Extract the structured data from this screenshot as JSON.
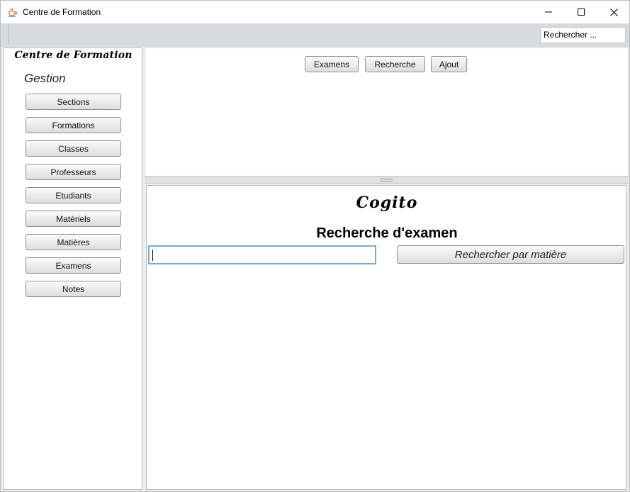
{
  "window": {
    "title": "Centre de Formation",
    "icon": "coffee-cup-app-icon"
  },
  "toolbar": {
    "search_value": "Rechercher ..."
  },
  "sidebar": {
    "brand": "Centre de Formation",
    "section_label": "Gestion",
    "items": [
      {
        "label": "Sections"
      },
      {
        "label": "Formations"
      },
      {
        "label": "Classes"
      },
      {
        "label": "Professeurs"
      },
      {
        "label": "Etudiants"
      },
      {
        "label": "Matériels"
      },
      {
        "label": "Matières"
      },
      {
        "label": "Examens"
      },
      {
        "label": "Notes"
      }
    ]
  },
  "top_panel": {
    "buttons": [
      {
        "label": "Examens"
      },
      {
        "label": "Recherche"
      },
      {
        "label": "Ajout"
      }
    ]
  },
  "main": {
    "logo_text": "Cogito",
    "title": "Recherche d'examen",
    "search_value": "",
    "search_button_label": "Rechercher par matière"
  },
  "colors": {
    "toolbar_bg": "#d7dae0",
    "input_focus_border": "#7aa7d9",
    "panel_bg": "#ffffff"
  }
}
